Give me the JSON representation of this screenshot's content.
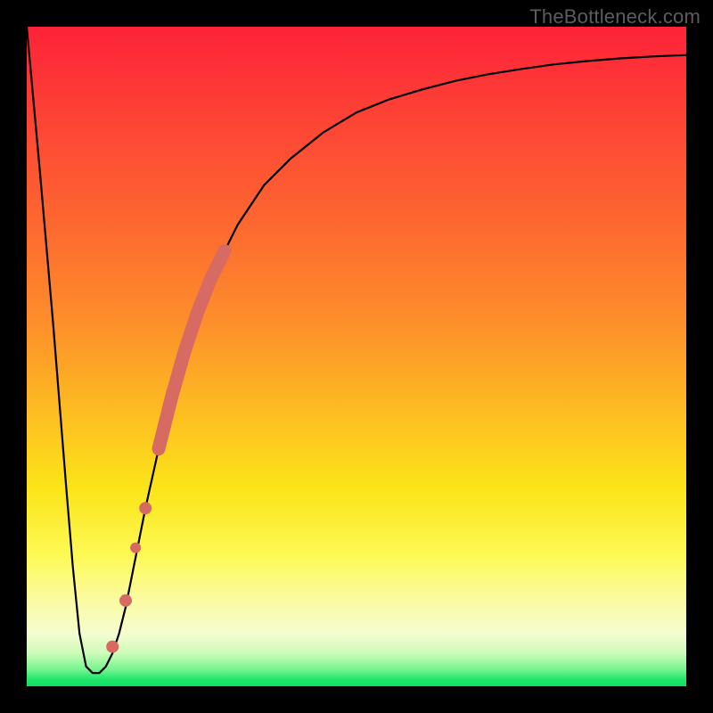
{
  "watermark": {
    "text": "TheBottleneck.com"
  },
  "chart_data": {
    "type": "line",
    "title": "",
    "xlabel": "",
    "ylabel": "",
    "xlim": [
      0,
      100
    ],
    "ylim": [
      0,
      100
    ],
    "grid": false,
    "legend": false,
    "background_gradient": {
      "direction": "vertical",
      "stops": [
        {
          "pos": 0,
          "color": "#fd2238"
        },
        {
          "pos": 30,
          "color": "#fd6830"
        },
        {
          "pos": 58,
          "color": "#fdbb22"
        },
        {
          "pos": 80,
          "color": "#fdf954"
        },
        {
          "pos": 92,
          "color": "#f5fdd0"
        },
        {
          "pos": 100,
          "color": "#0ee060"
        }
      ]
    },
    "series": [
      {
        "name": "bottleneck-curve",
        "color": "#000000",
        "stroke_width": 2,
        "x": [
          0,
          2,
          4,
          6,
          7,
          8,
          9,
          10,
          11,
          12,
          13,
          14,
          15,
          16,
          18,
          20,
          22,
          24,
          26,
          28,
          30,
          32,
          36,
          40,
          45,
          50,
          55,
          60,
          65,
          70,
          75,
          80,
          85,
          90,
          95,
          100
        ],
        "values": [
          100,
          78,
          55,
          30,
          18,
          8,
          3,
          2,
          2,
          3,
          5,
          8,
          12,
          17,
          27,
          36,
          44,
          51,
          57,
          62,
          66,
          70,
          76,
          80,
          84,
          87,
          89,
          90.5,
          91.8,
          92.8,
          93.6,
          94.3,
          94.8,
          95.2,
          95.5,
          95.7
        ]
      }
    ],
    "highlight_segment": {
      "color": "#d76a62",
      "stroke_width": 10,
      "x": [
        20,
        22,
        24,
        26,
        28,
        30
      ],
      "values": [
        36,
        44,
        51,
        57,
        62,
        66
      ]
    },
    "highlight_points": {
      "color": "#d76a62",
      "radius": 6,
      "points": [
        {
          "x": 18,
          "y": 27
        },
        {
          "x": 16.5,
          "y": 21
        },
        {
          "x": 15,
          "y": 13
        },
        {
          "x": 13,
          "y": 6
        }
      ]
    }
  }
}
